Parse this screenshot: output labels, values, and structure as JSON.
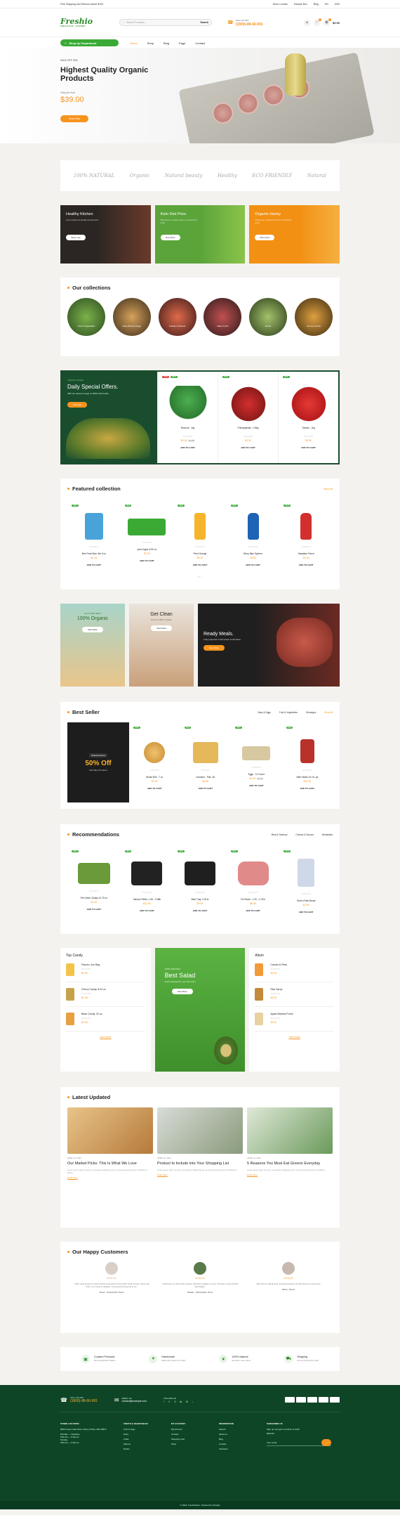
{
  "topbar": {
    "left": "Free Shipping and Returns above $100",
    "links": [
      "Store Locator",
      "Sample Box",
      "Blog"
    ],
    "lang": "EN",
    "currency": "USD"
  },
  "header": {
    "logo": "Freshio",
    "logo_sub": "ORGANIC STORE",
    "search_placeholder": "Search Products...",
    "search_button": "Search",
    "phone_label": "CALL US 24/7",
    "phone": "(1800)-88-66-991",
    "cart_count": "0",
    "wish_count": "0",
    "cart_total": "$0.00"
  },
  "nav": {
    "dept": "Shop by Department",
    "menu": [
      "Home",
      "Shop",
      "Blog",
      "Page",
      "Contact"
    ]
  },
  "hero": {
    "tag": "SALE OFF 30%",
    "title": "Highest Quality Organic Products",
    "from": "Only per from",
    "price": "$39.00",
    "button": "Shop Now"
  },
  "brands": [
    "100% NATURAL",
    "Organic",
    "Natural beauty",
    "Healthy",
    "ECO FRIENDLY",
    "Natural"
  ],
  "banners": [
    {
      "title": "Healthy Kitchen",
      "sub": "Lorem ipsum is simply dummy text",
      "btn": "Shop now",
      "color": "#2b2623"
    },
    {
      "title": "Keto Diet Price",
      "sub": "Shop from a simple store to convenient price",
      "btn": "View More",
      "color": "#5ba43a"
    },
    {
      "title": "Organic Honey",
      "sub": "Shop from a simple store to convenient price",
      "btn": "Shop Now",
      "color": "#f29013"
    }
  ],
  "collections": {
    "title": "Our collections",
    "items": [
      "Fruit & Vegetables",
      "Dairy Bread & Eggs",
      "Snacks & Sweets",
      "Meat & Fish",
      "Drinks",
      "Grocery Foods"
    ]
  },
  "daily": {
    "label": "LIMITED OFFER",
    "title": "Daily Special Offers.",
    "sub": "With our deserve range of 100% fresh foods.",
    "btn": "Shop All",
    "products": [
      {
        "badges": [
          "-25%",
          "NEW"
        ],
        "name": "Broccoli - 1kg",
        "price": "$3.99",
        "old": "$4.99",
        "btn": "ADD TO CART"
      },
      {
        "badges": [
          "NEW"
        ],
        "name": "Pomegranate - 0.5kg",
        "price": "$3.00",
        "old": "",
        "btn": "ADD TO CART"
      },
      {
        "badges": [
          "NEW"
        ],
        "name": "Tomato - 1kg",
        "price": "$3.89",
        "old": "",
        "btn": "ADD TO CART"
      }
    ]
  },
  "featured": {
    "title": "Featured collection",
    "shop_all": "Shop All",
    "products": [
      {
        "badge": "NEW",
        "name": "Bee Fresh Ban Jeb 5 oz",
        "price": "$3.18",
        "btn": "ADD TO CART"
      },
      {
        "badge": "NEW",
        "name": "prem Apple 4/20 oz",
        "price": "$7.99",
        "btn": "ADD TO CART"
      },
      {
        "badge": "NEW",
        "name": "Flent Orange",
        "price": "$3.43",
        "btn": "ADD TO CART"
      },
      {
        "badge": "NEW",
        "name": "Berry Blue Spinner",
        "price": "$3.80",
        "btn": "ADD TO CART"
      },
      {
        "badge": "NEW",
        "name": "Hawaiian Punch",
        "price": "$3.40",
        "btn": "ADD TO CART"
      }
    ]
  },
  "promos": [
    {
      "label": "ECO CERTIFIED",
      "title": "100% Organic",
      "btn": "View More"
    },
    {
      "title": "Get Clean",
      "sub": "Fresh & 100% Organic",
      "btn": "View More"
    },
    {
      "title": "Ready Meals.",
      "sub": "Fully prepared to fall tested combination.",
      "btn": "View More"
    }
  ],
  "bestseller": {
    "title": "Best Seller",
    "tabs": [
      "Dairy & Eggs",
      "Fruit & Vegetables",
      "Drinkages",
      "Shop All"
    ],
    "banner": {
      "label": "Selected Items",
      "title": "50% Off",
      "sub": "Fall Sale Pumpkins"
    },
    "products": [
      {
        "badge": "NEW",
        "name": "Bread Roll - 7 oz",
        "price": "$2.39",
        "old": "",
        "btn": "ADD TO CART"
      },
      {
        "badge": "NEW",
        "name": "Crackers - Plat. 1lb",
        "price": "$3.98",
        "old": "",
        "btn": "ADD TO CART"
      },
      {
        "badge": "NEW",
        "name": "Eggs - 12 Count",
        "price": "$4.99",
        "old": "$6.00",
        "btn": "ADD TO CART"
      },
      {
        "badge": "NEW",
        "name": "Little Hands 24 Oz. jar",
        "price": "$10.33",
        "old": "",
        "btn": "ADD TO CART"
      }
    ]
  },
  "recommend": {
    "title": "Recommendations",
    "tabs": [
      "Meat & Seafood",
      "Cheese & Sauces",
      "Breakfasts"
    ],
    "products": [
      {
        "badge": "NEW",
        "name": "Pet Green Chalky 12.75 oz",
        "price": "$1.33",
        "btn": "ADD TO CART"
      },
      {
        "badge": "NEW",
        "name": "Salmon Fillets, 1.08 - 2.08lb",
        "price": "$12.00",
        "btn": "ADD TO CART"
      },
      {
        "badge": "NEW",
        "name": "Beef Tray, 2.25 lb",
        "price": "$9.93",
        "btn": "ADD TO CART"
      },
      {
        "badge": "NEW",
        "name": "Fix Roast - 1.25 - 2.75 lb",
        "price": "$6.98",
        "btn": "ADD TO CART"
      },
      {
        "badge": "NEW",
        "name": "Grils's Pride Bread",
        "price": "$2.99",
        "btn": "ADD TO CART"
      }
    ]
  },
  "topcandy": {
    "title": "Top Candy",
    "items": [
      {
        "name": "Flavors, 4oz Bag",
        "price": "$4.36"
      },
      {
        "name": "Cherry Candy, 8.04 oz",
        "price": "$4.36"
      },
      {
        "name": "Bean Candy, 32 oz",
        "price": "$4.36"
      }
    ],
    "more": "View More"
  },
  "salad": {
    "label": "100% ORGANIC",
    "title": "Best Salad",
    "sub": "Fresh selected for your first order",
    "btn": "View More"
  },
  "album": {
    "title": "Alium",
    "items": [
      {
        "name": "Carrots & Peas",
        "price": "$4.36"
      },
      {
        "name": "Rice Syrup",
        "price": "$3.00"
      },
      {
        "name": "Apple Banana Puree",
        "price": "$3.00"
      }
    ],
    "more": "View More"
  },
  "blog": {
    "title": "Latest Updated",
    "posts": [
      {
        "date": "APRIL 15, 2024",
        "title": "Our Market Picks: This Is What We Love",
        "excerpt": "Lorem ipsum dolor sit amet, consectetur adipiscing elit, sed do eiusmod tempor incididunt ut labore.",
        "more": "Read More"
      },
      {
        "date": "APRIL 15, 2024",
        "title": "Product to Include into Your Shopping List",
        "excerpt": "Lorem ipsum dolor sit amet, consectetur adipiscing elit, sed do eiusmod tempor incididunt ut.",
        "more": "Read More"
      },
      {
        "date": "APRIL 15, 2024",
        "title": "5 Reasons You Must Eat Greens Everyday",
        "excerpt": "Lorem ipsum dolor sit amet, consectetur adipiscing elit, sed do eiusmod tempor incididunt.",
        "more": "Read More"
      }
    ]
  },
  "testimonials": {
    "title": "Our Happy Customers",
    "items": [
      {
        "stars": "★★★★★",
        "text": "\" After using protein so many brands I just want to know why? Great service. Clean and fresh. It's a most of updates. I recommend everyone to try.\"",
        "name": "Sarah - Subscription Store"
      },
      {
        "stars": "★★★★★",
        "text": "\" Great store to shop fresh produce. Delivery is always on time. The team is very friendly and helpful.\"",
        "name": "Natalie - Subscription Store"
      },
      {
        "stars": "★★★★★",
        "text": "\" Best site for natural food, amazing selection and fair prices for every item.\"",
        "name": "Ethan - Buyer"
      }
    ]
  },
  "features": [
    {
      "title": "Curated Products",
      "sub": "Best Handpicked Sellers",
      "icon": "box"
    },
    {
      "title": "Handmade",
      "sub": "Made with passion for 2024",
      "icon": "heart"
    },
    {
      "title": "100% Natural",
      "sub": "Eat local, save nature",
      "icon": "leaf"
    },
    {
      "title": "Shipping",
      "sub": "Across Nearly Ever state",
      "icon": "truck"
    }
  ],
  "footer": {
    "phone_label": "CALL US 24/7",
    "phone": "(1800)-88-66-991",
    "mail_label": "EMAIL US",
    "mail": "contact@example.com",
    "follow": "FOLLOW US",
    "store_title": "STORE LOCATION",
    "store": [
      "9066 Green Lake Drive Chevy Chase, MD 20815",
      "Monday — Saturday",
      "9:00 am — 6:00 pm",
      "Sunday",
      "9:00 am — 5:00 pm"
    ],
    "c1_title": "FRUITS & VEGETABLES",
    "c1": [
      "Fruit & Vege",
      "Dairy",
      "Fruits",
      "Salmon",
      "Drinks"
    ],
    "c2_title": "MY ACCOUNT",
    "c2": [
      "My Account",
      "Contact",
      "Shopping Cart",
      "Shop"
    ],
    "c3_title": "INFORMATION",
    "c3": [
      "Search",
      "About us",
      "Blog",
      "Contact",
      "Checkout"
    ],
    "sub_title": "SUBSCRIBE US",
    "sub_text": "Sign up now get a voucher of worth",
    "sub_amount": "$100.00",
    "sub_placeholder": "Your email",
    "copyright": "© 2024. FreshioStore. Powered by Shopify"
  }
}
